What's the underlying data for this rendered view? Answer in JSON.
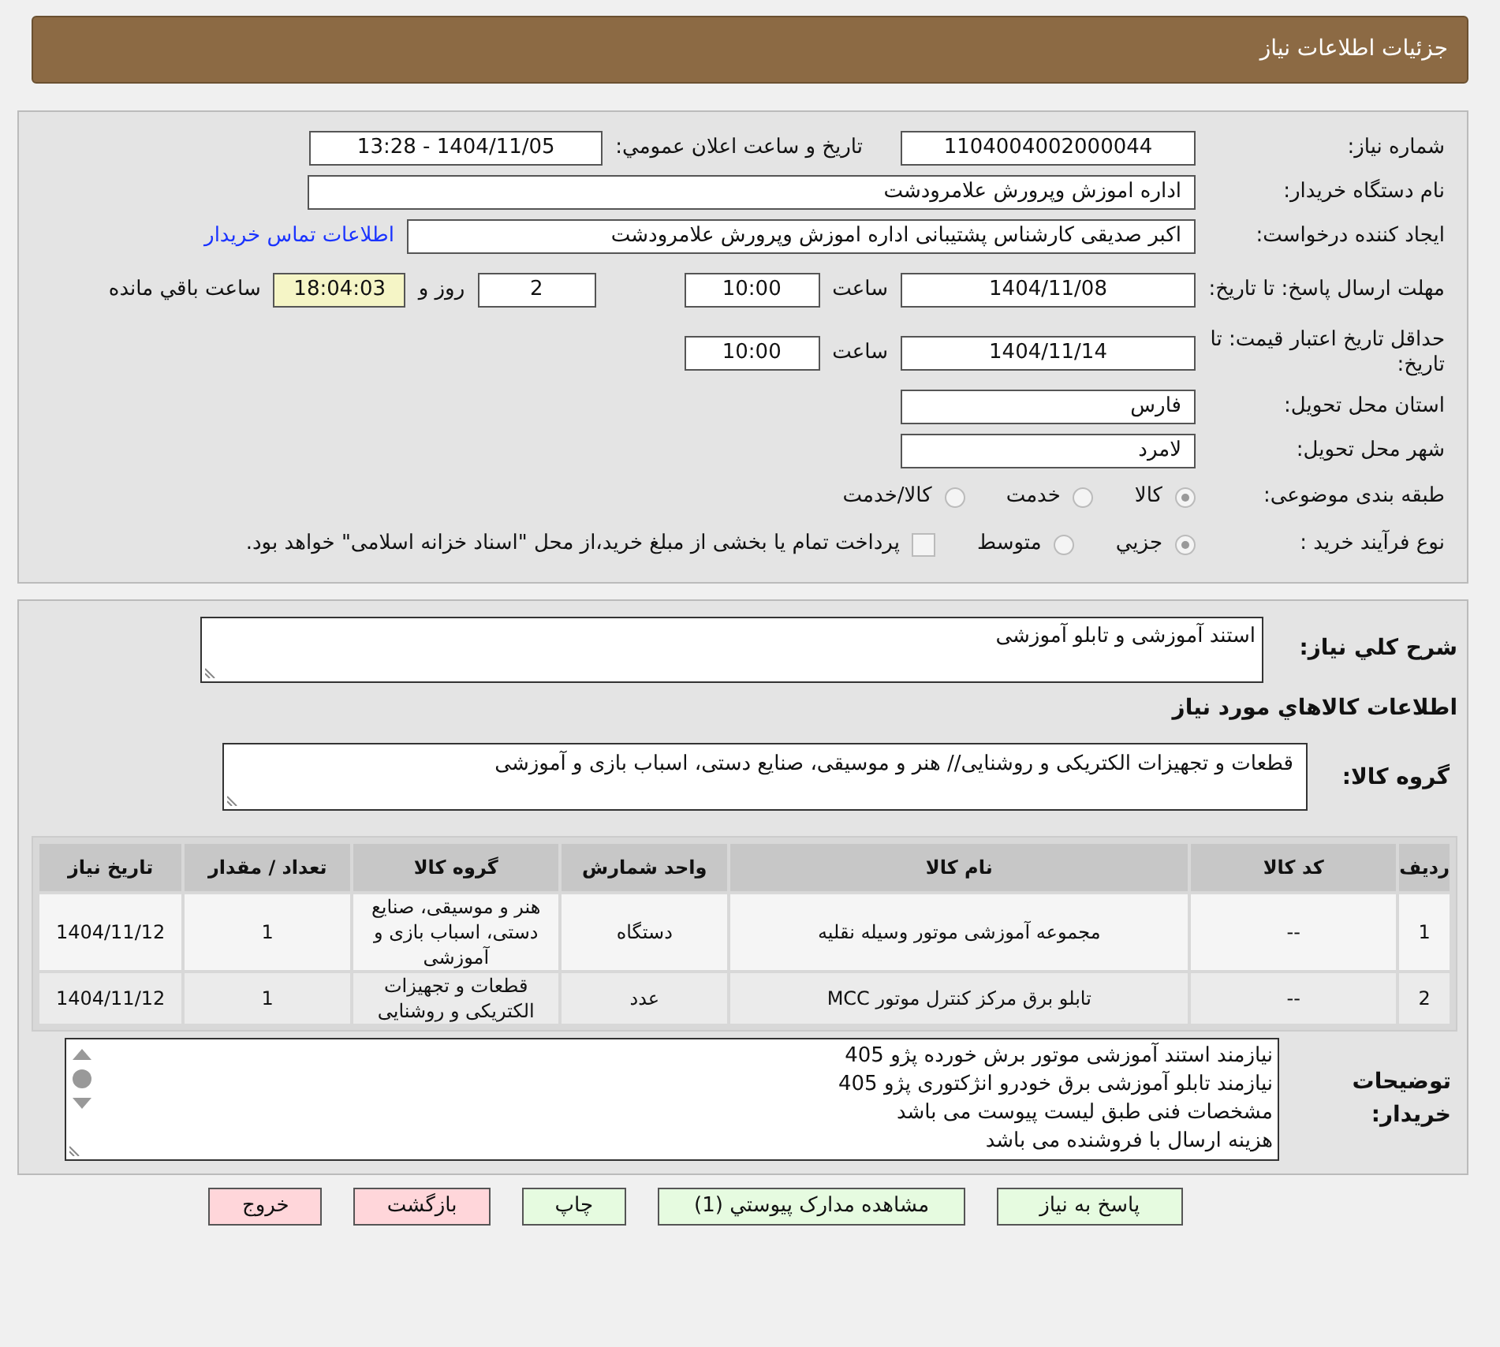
{
  "header": {
    "title": "جزئیات اطلاعات نیاز"
  },
  "need_number": {
    "label": "شماره نیاز:",
    "value": "1104004002000044"
  },
  "announce": {
    "label": "تاریخ و ساعت اعلان عمومي:",
    "value": "1404/11/05 - 13:28"
  },
  "buyer_org": {
    "label": "نام دستگاه خریدار:",
    "value": "اداره اموزش وپرورش علامرودشت"
  },
  "requester": {
    "label": "ایجاد کننده درخواست:",
    "value": "اکبر صدیقی کارشناس پشتیبانی اداره اموزش وپرورش علامرودشت",
    "link": "اطلاعات تماس خریدار"
  },
  "reply_deadline": {
    "label": "مهلت ارسال پاسخ: تا تاریخ:",
    "date": "1404/11/08",
    "time_label": "ساعت",
    "time": "10:00",
    "days": "2",
    "days_label": "روز و",
    "remaining": "18:04:03",
    "remaining_label": "ساعت باقي مانده"
  },
  "price_validity": {
    "label": "حداقل تاریخ اعتبار قیمت: تا تاریخ:",
    "date": "1404/11/14",
    "time_label": "ساعت",
    "time": "10:00"
  },
  "province": {
    "label": "استان محل تحویل:",
    "value": "فارس"
  },
  "city": {
    "label": "شهر محل تحویل:",
    "value": "لامرد"
  },
  "category": {
    "label": "طبقه بندی موضوعی:",
    "options": [
      {
        "label": "کالا",
        "selected": true
      },
      {
        "label": "خدمت",
        "selected": false
      },
      {
        "label": "کالا/خدمت",
        "selected": false
      }
    ]
  },
  "process": {
    "label": "نوع فرآیند خرید :",
    "options": [
      {
        "label": "جزيي",
        "selected": true
      },
      {
        "label": "متوسط",
        "selected": false
      }
    ],
    "treasury": {
      "checked": false,
      "label": "پرداخت تمام یا بخشی از مبلغ خرید،از محل \"اسناد خزانه اسلامی\" خواهد بود."
    }
  },
  "description": {
    "label": "شرح کلي نياز:",
    "value": "استند آموزشی و تابلو آموزشی"
  },
  "goods_title": "اطلاعات کالاهاي مورد نياز",
  "goods_group": {
    "label": "گروه کالا:",
    "value": "قطعات و تجهیزات الکتریکی و روشنایی// هنر و موسیقی، صنایع دستی، اسباب بازی و آموزشی"
  },
  "table": {
    "columns": [
      "ردیف",
      "کد کالا",
      "نام کالا",
      "واحد شمارش",
      "گروه کالا",
      "تعداد / مقدار",
      "تاریخ نیاز"
    ],
    "rows": [
      [
        "1",
        "--",
        "مجموعه آموزشی موتور وسیله نقلیه",
        "دستگاه",
        "هنر و موسیقی، صنایع دستی، اسباب بازی و آموزشی",
        "1",
        "1404/11/12"
      ],
      [
        "2",
        "--",
        "تابلو برق مرکز کنترل موتور MCC",
        "عدد",
        "قطعات و تجهیزات الکتریکی و روشنایی",
        "1",
        "1404/11/12"
      ]
    ]
  },
  "buyer_notes": {
    "label": "توضیحات خریدار:",
    "lines": [
      "نیازمند استند آموزشی موتور برش خورده پژو 405",
      "نیازمند تابلو آموزشی برق خودرو انژکتوری پژو 405",
      "مشخصات فنی طبق لیست پیوست می باشد",
      "هزینه ارسال با فروشنده می باشد"
    ]
  },
  "buttons": [
    {
      "label": "پاسخ به نیاز",
      "color": "#e6fbe0"
    },
    {
      "label": "مشاهده مدارک پیوستي (1)",
      "color": "#e6fbe0"
    },
    {
      "label": "چاپ",
      "color": "#e6fbe0"
    },
    {
      "label": "بازگشت",
      "color": "#ffd6da"
    },
    {
      "label": "خروج",
      "color": "#ffd6da"
    }
  ]
}
